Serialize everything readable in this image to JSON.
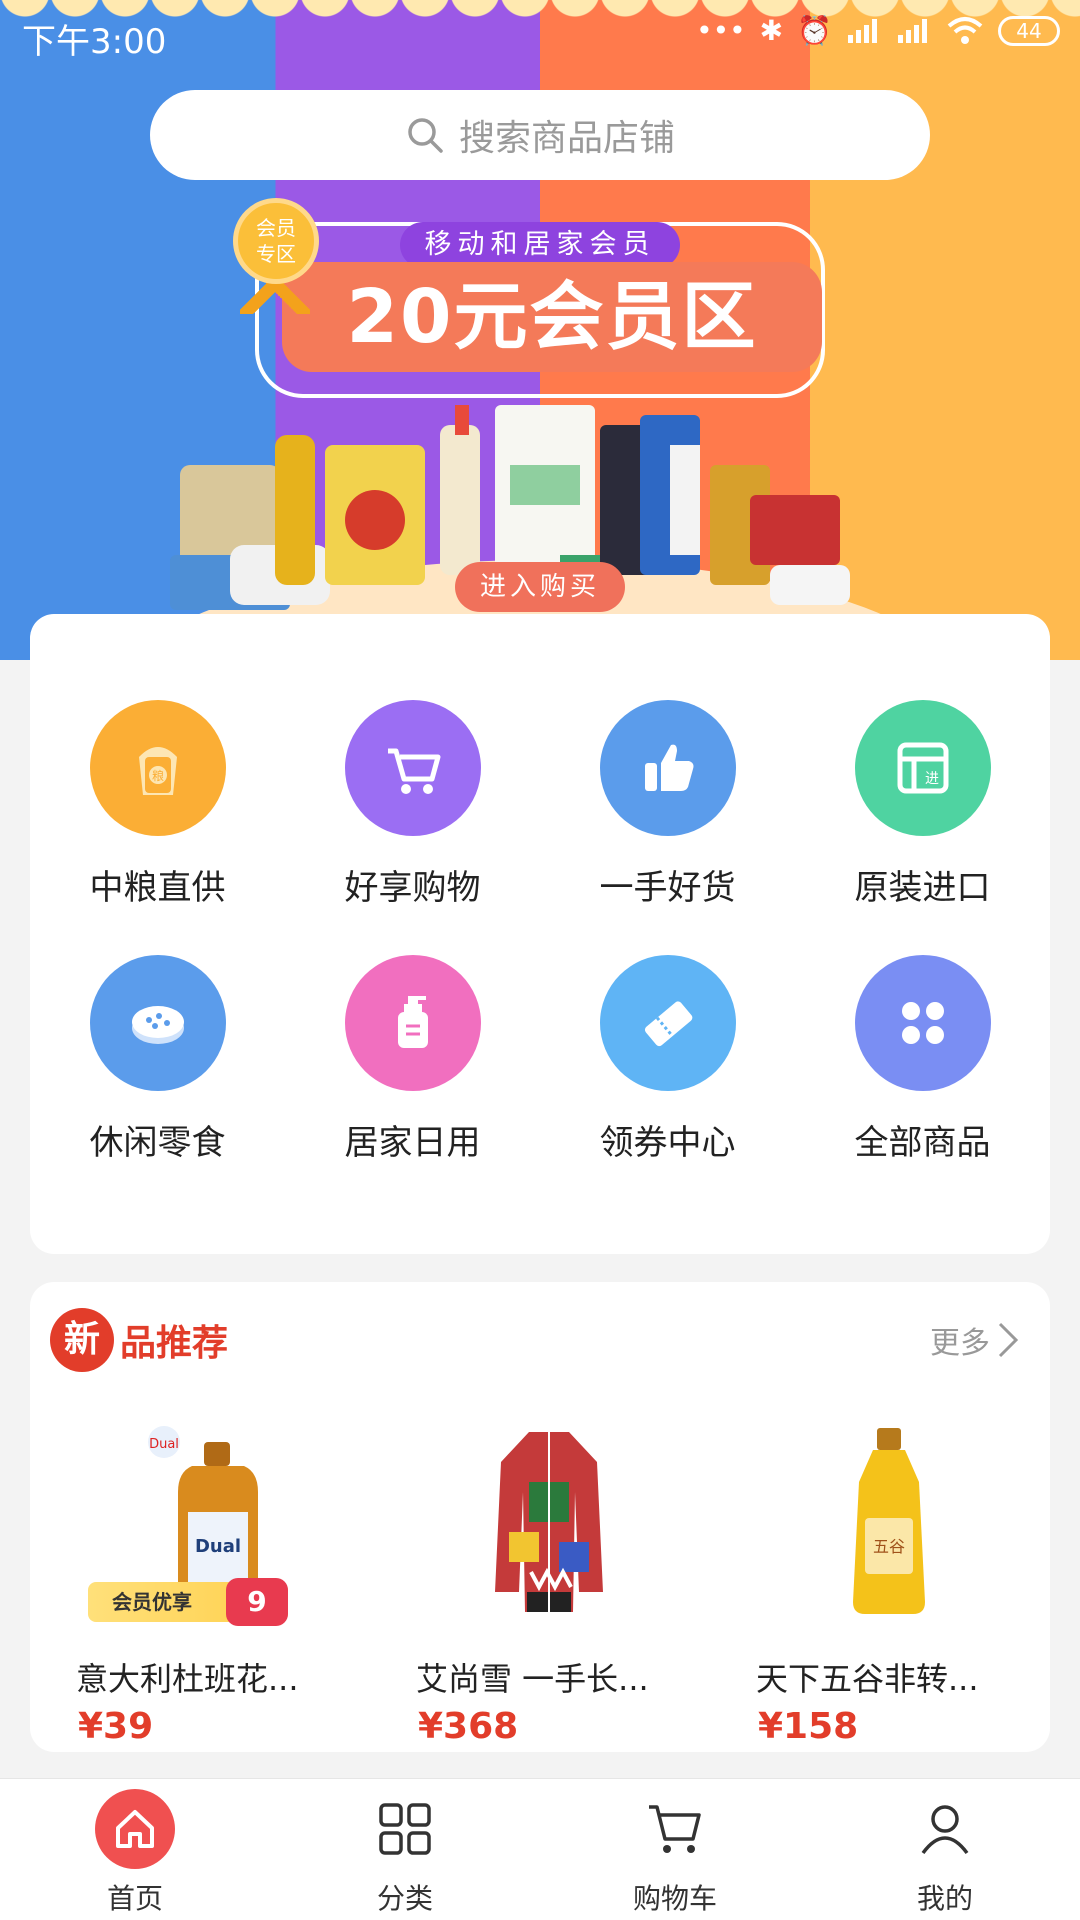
{
  "status_bar": {
    "time": "下午3:00",
    "battery": "44"
  },
  "search": {
    "placeholder": "搜索商品店铺"
  },
  "banner": {
    "badge_line1": "会员",
    "badge_line2": "专区",
    "subtitle": "移动和居家会员",
    "title": "20元会员区",
    "cta": "进入购买"
  },
  "categories": [
    {
      "label": "中粮直供",
      "icon": "grain-bag-icon",
      "color": "#fbae35"
    },
    {
      "label": "好享购物",
      "icon": "shopping-cart-icon",
      "color": "#9b6ef3"
    },
    {
      "label": "一手好货",
      "icon": "thumbs-up-icon",
      "color": "#5b9ceb"
    },
    {
      "label": "原装进口",
      "icon": "import-box-icon",
      "color": "#4fd3a1"
    },
    {
      "label": "休闲零食",
      "icon": "biscuit-icon",
      "color": "#5b9ceb"
    },
    {
      "label": "居家日用",
      "icon": "soap-bottle-icon",
      "color": "#f16fbf"
    },
    {
      "label": "领券中心",
      "icon": "coupon-icon",
      "color": "#5fb4f5"
    },
    {
      "label": "全部商品",
      "icon": "grid-flower-icon",
      "color": "#7a8ef3"
    }
  ],
  "new_section": {
    "tag": "新",
    "title": "品推荐",
    "more": "更多",
    "products": [
      {
        "name": "意大利杜班花...",
        "price": "¥39",
        "member_label": "会员优享",
        "member_num": "9"
      },
      {
        "name": "艾尚雪 一手长...",
        "price": "¥368"
      },
      {
        "name": "天下五谷非转...",
        "price": "¥158"
      }
    ]
  },
  "tabs": [
    {
      "label": "首页",
      "icon": "home-icon",
      "active": true
    },
    {
      "label": "分类",
      "icon": "category-grid-icon"
    },
    {
      "label": "购物车",
      "icon": "cart-icon"
    },
    {
      "label": "我的",
      "icon": "profile-icon"
    }
  ],
  "colors": {
    "accent": "#e23d2a",
    "tab_active": "#f05050"
  }
}
